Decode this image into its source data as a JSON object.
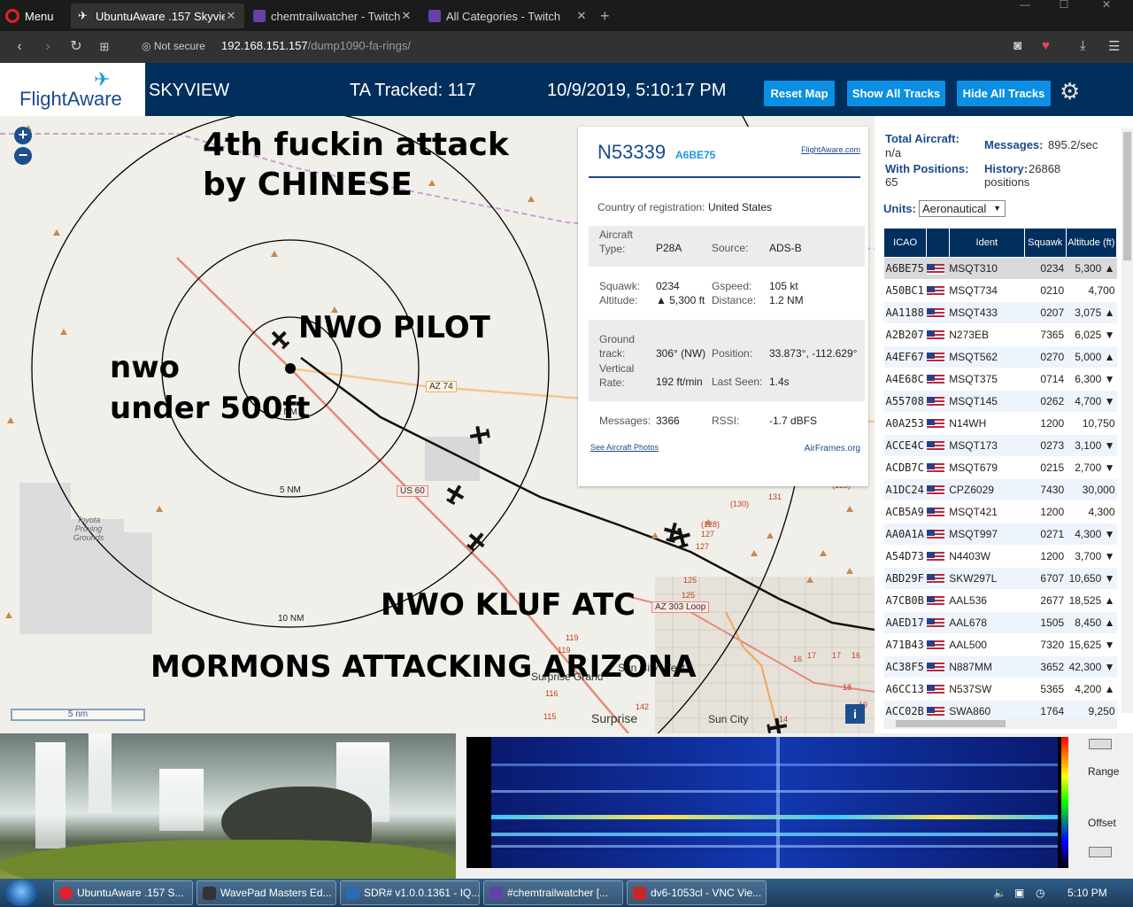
{
  "browser": {
    "menu_label": "Menu",
    "tabs": [
      {
        "label": "UbuntuAware .157 Skyview",
        "icon": "plane-icon",
        "active": true
      },
      {
        "label": "chemtrailwatcher - Twitch",
        "icon": "twitch-icon",
        "active": false
      },
      {
        "label": "All Categories - Twitch",
        "icon": "twitch-icon",
        "active": false
      }
    ],
    "not_secure": "Not secure",
    "url_host": "192.168.151.157",
    "url_path": "/dump1090-fa-rings/"
  },
  "header": {
    "logo": "FlightAware",
    "app_name": "SKYVIEW",
    "tracked": "TA Tracked: 117",
    "datetime": "10/9/2019, 5:10:17 PM",
    "buttons": {
      "reset_map": "Reset Map",
      "show_all": "Show All Tracks",
      "hide_all": "Hide All Tracks"
    }
  },
  "map": {
    "overlays": {
      "line1": "4th fuckin attack",
      "line2": "by CHINESE",
      "nwo_pilot": "NWO PILOT",
      "nwo": "nwo",
      "under": "under 500ft",
      "kluf": "NWO KLUF ATC",
      "mormons": "MORMONS ATTACKING ARIZONA"
    },
    "range_labels": [
      "2 NM",
      "5 NM",
      "10 NM"
    ],
    "road_labels": {
      "az74": "AZ 74",
      "us60": "US 60",
      "az303": "AZ 303 Loop"
    },
    "place_labels": {
      "toyota": "Toyota Proving Grounds",
      "surprise": "Surprise",
      "sun_city": "Sun City",
      "sun_city_west": "Sun City West",
      "surprise_grand": "Surprise Grand"
    },
    "route_numbers": [
      "(130)",
      "(128)",
      "127",
      "127",
      "125",
      "125",
      "131",
      "119",
      "119",
      "116",
      "115",
      "142",
      "16",
      "17",
      "17",
      "16",
      "18",
      "19",
      "14",
      "(135)"
    ],
    "scale": "5 nm",
    "info": "i"
  },
  "selected": {
    "callsign": "N53339",
    "icao": "A6BE75",
    "fa_link": "FlightAware.com",
    "country_label": "Country of registration:",
    "country": "United States",
    "aircraft_type_label": "Aircraft Type:",
    "aircraft_type": "P28A",
    "source_label": "Source:",
    "source": "ADS-B",
    "squawk_label": "Squawk:",
    "squawk": "0234",
    "gspeed_label": "Gspeed:",
    "gspeed": "105 kt",
    "altitude_label": "Altitude:",
    "altitude": "▲ 5,300 ft",
    "distance_label": "Distance:",
    "distance": "1.2 NM",
    "track_label": "Ground track:",
    "track": "306° (NW)",
    "position_label": "Position:",
    "position": "33.873°, -112.629°",
    "vrate_label": "Vertical Rate:",
    "vrate": "192 ft/min",
    "lastseen_label": "Last Seen:",
    "lastseen": "1.4s",
    "messages_label": "Messages:",
    "messages": "3366",
    "rssi_label": "RSSI:",
    "rssi": "-1.7 dBFS",
    "photos_link": "See Aircraft Photos",
    "airframes_link": "AirFrames.org"
  },
  "side": {
    "total_label": "Total Aircraft:",
    "total": "n/a",
    "positions_label": "With Positions:",
    "positions": "65",
    "messages_label": "Messages:",
    "messages": "895.2/sec",
    "history_label": "History:",
    "history": "26868",
    "history_unit": "positions",
    "units_label": "Units:",
    "units_value": "Aeronautical",
    "columns": [
      "ICAO",
      "",
      "Ident",
      "Squawk",
      "Altitude (ft)"
    ],
    "rows": [
      {
        "icao": "A6BE75",
        "ident": "MSQT310",
        "squawk": "0234",
        "alt": "5,300 ▲"
      },
      {
        "icao": "A50BC1",
        "ident": "MSQT734",
        "squawk": "0210",
        "alt": "4,700"
      },
      {
        "icao": "AA1188",
        "ident": "MSQT433",
        "squawk": "0207",
        "alt": "3,075 ▲"
      },
      {
        "icao": "A2B207",
        "ident": "N273EB",
        "squawk": "7365",
        "alt": "6,025 ▼"
      },
      {
        "icao": "A4EF67",
        "ident": "MSQT562",
        "squawk": "0270",
        "alt": "5,000 ▲"
      },
      {
        "icao": "A4E68C",
        "ident": "MSQT375",
        "squawk": "0714",
        "alt": "6,300 ▼"
      },
      {
        "icao": "A55708",
        "ident": "MSQT145",
        "squawk": "0262",
        "alt": "4,700 ▼"
      },
      {
        "icao": "A0A253",
        "ident": "N14WH",
        "squawk": "1200",
        "alt": "10,750"
      },
      {
        "icao": "ACCE4C",
        "ident": "MSQT173",
        "squawk": "0273",
        "alt": "3,100 ▼"
      },
      {
        "icao": "ACDB7C",
        "ident": "MSQT679",
        "squawk": "0215",
        "alt": "2,700 ▼"
      },
      {
        "icao": "A1DC24",
        "ident": "CPZ6029",
        "squawk": "7430",
        "alt": "30,000"
      },
      {
        "icao": "ACB5A9",
        "ident": "MSQT421",
        "squawk": "1200",
        "alt": "4,300"
      },
      {
        "icao": "AA0A1A",
        "ident": "MSQT997",
        "squawk": "0271",
        "alt": "4,300 ▼"
      },
      {
        "icao": "A54D73",
        "ident": "N4403W",
        "squawk": "1200",
        "alt": "3,700 ▼"
      },
      {
        "icao": "ABD29F",
        "ident": "SKW297L",
        "squawk": "6707",
        "alt": "10,650 ▼"
      },
      {
        "icao": "A7CB0B",
        "ident": "AAL536",
        "squawk": "2677",
        "alt": "18,525 ▲"
      },
      {
        "icao": "AAED17",
        "ident": "AAL678",
        "squawk": "1505",
        "alt": "8,450 ▲"
      },
      {
        "icao": "A71B43",
        "ident": "AAL500",
        "squawk": "7320",
        "alt": "15,625 ▼"
      },
      {
        "icao": "AC38F5",
        "ident": "N887MM",
        "squawk": "3652",
        "alt": "42,300 ▼"
      },
      {
        "icao": "A6CC13",
        "ident": "N537SW",
        "squawk": "5365",
        "alt": "4,200 ▲"
      },
      {
        "icao": "ACC02B",
        "ident": "SWA860",
        "squawk": "1764",
        "alt": "9,250"
      }
    ]
  },
  "sdr": {
    "range": "Range",
    "offset": "Offset"
  },
  "taskbar": {
    "items": [
      {
        "label": "UbuntuAware .157 S...",
        "icon": "opera-icon",
        "color": "#e0202a"
      },
      {
        "label": "WavePad Masters Ed...",
        "icon": "wavepad-icon",
        "color": "#333333"
      },
      {
        "label": "SDR# v1.0.0.1361 - IQ...",
        "icon": "sdr-icon",
        "color": "#2a6bb3"
      },
      {
        "label": "#chemtrailwatcher [...",
        "icon": "twitch-icon",
        "color": "#6441a5"
      },
      {
        "label": "dv6-1053cl - VNC Vie...",
        "icon": "vnc-icon",
        "color": "#c62828"
      }
    ],
    "clock": "5:10 PM"
  }
}
